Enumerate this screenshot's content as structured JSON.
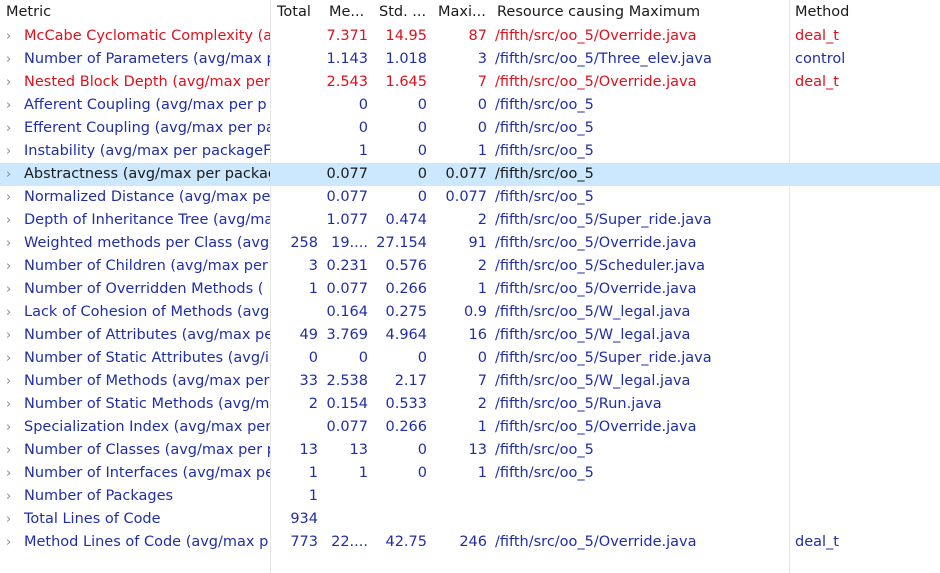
{
  "columns": {
    "metric": "Metric",
    "total": "Total",
    "mean": "Me...",
    "std": "Std. ...",
    "max": "Maxi...",
    "resource": "Resource causing Maximum",
    "method": "Method"
  },
  "chevron_icon": "chevron-right-icon",
  "colors": {
    "default": "#1f2ea8",
    "warning": "#e0101c",
    "selected_bg": "#cce8ff"
  },
  "rows": [
    {
      "metric": "McCabe Cyclomatic Complexity (a",
      "total": "",
      "mean": "7.371",
      "std": "14.95",
      "max": "87",
      "resource": "/fifth/src/oo_5/Override.java",
      "method": "deal_t",
      "style": "red"
    },
    {
      "metric": "Number of Parameters (avg/max p",
      "total": "",
      "mean": "1.143",
      "std": "1.018",
      "max": "3",
      "resource": "/fifth/src/oo_5/Three_elev.java",
      "method": "control",
      "style": "blue"
    },
    {
      "metric": "Nested Block Depth (avg/max per",
      "total": "",
      "mean": "2.543",
      "std": "1.645",
      "max": "7",
      "resource": "/fifth/src/oo_5/Override.java",
      "method": "deal_t",
      "style": "red"
    },
    {
      "metric": "Afferent Coupling (avg/max per p",
      "total": "",
      "mean": "0",
      "std": "0",
      "max": "0",
      "resource": "/fifth/src/oo_5",
      "method": "",
      "style": "blue"
    },
    {
      "metric": "Efferent Coupling (avg/max per pa",
      "total": "",
      "mean": "0",
      "std": "0",
      "max": "0",
      "resource": "/fifth/src/oo_5",
      "method": "",
      "style": "blue"
    },
    {
      "metric": "Instability (avg/max per packageFr",
      "total": "",
      "mean": "1",
      "std": "0",
      "max": "1",
      "resource": "/fifth/src/oo_5",
      "method": "",
      "style": "blue"
    },
    {
      "metric": "Abstractness (avg/max per packag",
      "total": "",
      "mean": "0.077",
      "std": "0",
      "max": "0.077",
      "resource": "/fifth/src/oo_5",
      "method": "",
      "style": "black",
      "selected": true
    },
    {
      "metric": "Normalized Distance (avg/max pe",
      "total": "",
      "mean": "0.077",
      "std": "0",
      "max": "0.077",
      "resource": "/fifth/src/oo_5",
      "method": "",
      "style": "blue"
    },
    {
      "metric": "Depth of Inheritance Tree (avg/ma",
      "total": "",
      "mean": "1.077",
      "std": "0.474",
      "max": "2",
      "resource": "/fifth/src/oo_5/Super_ride.java",
      "method": "",
      "style": "blue"
    },
    {
      "metric": "Weighted methods per Class (avg",
      "total": "258",
      "mean": "19....",
      "std": "27.154",
      "max": "91",
      "resource": "/fifth/src/oo_5/Override.java",
      "method": "",
      "style": "blue"
    },
    {
      "metric": "Number of Children (avg/max per",
      "total": "3",
      "mean": "0.231",
      "std": "0.576",
      "max": "2",
      "resource": "/fifth/src/oo_5/Scheduler.java",
      "method": "",
      "style": "blue"
    },
    {
      "metric": "Number of Overridden Methods (",
      "total": "1",
      "mean": "0.077",
      "std": "0.266",
      "max": "1",
      "resource": "/fifth/src/oo_5/Override.java",
      "method": "",
      "style": "blue"
    },
    {
      "metric": "Lack of Cohesion of Methods (avg",
      "total": "",
      "mean": "0.164",
      "std": "0.275",
      "max": "0.9",
      "resource": "/fifth/src/oo_5/W_legal.java",
      "method": "",
      "style": "blue"
    },
    {
      "metric": "Number of Attributes (avg/max pe",
      "total": "49",
      "mean": "3.769",
      "std": "4.964",
      "max": "16",
      "resource": "/fifth/src/oo_5/W_legal.java",
      "method": "",
      "style": "blue"
    },
    {
      "metric": "Number of Static Attributes (avg/i",
      "total": "0",
      "mean": "0",
      "std": "0",
      "max": "0",
      "resource": "/fifth/src/oo_5/Super_ride.java",
      "method": "",
      "style": "blue"
    },
    {
      "metric": "Number of Methods (avg/max per",
      "total": "33",
      "mean": "2.538",
      "std": "2.17",
      "max": "7",
      "resource": "/fifth/src/oo_5/W_legal.java",
      "method": "",
      "style": "blue"
    },
    {
      "metric": "Number of Static Methods (avg/m",
      "total": "2",
      "mean": "0.154",
      "std": "0.533",
      "max": "2",
      "resource": "/fifth/src/oo_5/Run.java",
      "method": "",
      "style": "blue"
    },
    {
      "metric": "Specialization Index (avg/max per",
      "total": "",
      "mean": "0.077",
      "std": "0.266",
      "max": "1",
      "resource": "/fifth/src/oo_5/Override.java",
      "method": "",
      "style": "blue"
    },
    {
      "metric": "Number of Classes (avg/max per p",
      "total": "13",
      "mean": "13",
      "std": "0",
      "max": "13",
      "resource": "/fifth/src/oo_5",
      "method": "",
      "style": "blue"
    },
    {
      "metric": "Number of Interfaces (avg/max pe",
      "total": "1",
      "mean": "1",
      "std": "0",
      "max": "1",
      "resource": "/fifth/src/oo_5",
      "method": "",
      "style": "blue"
    },
    {
      "metric": "Number of Packages",
      "total": "1",
      "mean": "",
      "std": "",
      "max": "",
      "resource": "",
      "method": "",
      "style": "blue"
    },
    {
      "metric": "Total Lines of Code",
      "total": "934",
      "mean": "",
      "std": "",
      "max": "",
      "resource": "",
      "method": "",
      "style": "blue"
    },
    {
      "metric": "Method Lines of Code (avg/max p",
      "total": "773",
      "mean": "22....",
      "std": "42.75",
      "max": "246",
      "resource": "/fifth/src/oo_5/Override.java",
      "method": "deal_t",
      "style": "blue"
    }
  ]
}
